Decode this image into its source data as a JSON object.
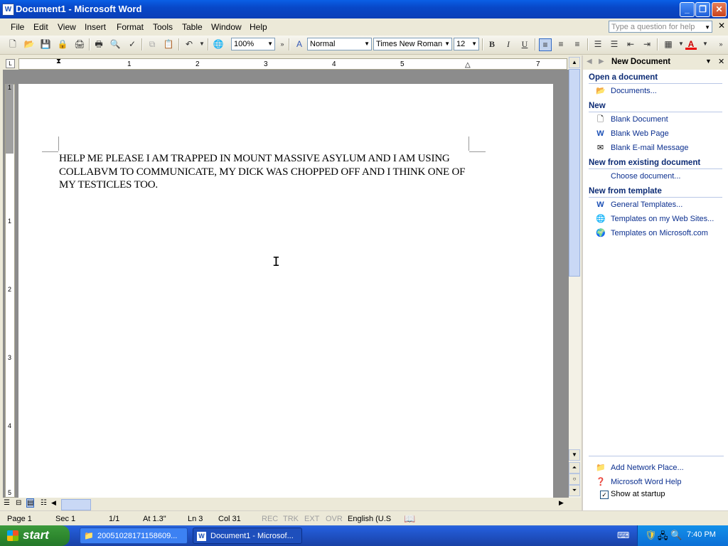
{
  "window": {
    "title": "Document1 - Microsoft Word",
    "app_icon": "W",
    "min": "_",
    "max": "❐",
    "close": "✕"
  },
  "menu": {
    "items": [
      "File",
      "Edit",
      "View",
      "Insert",
      "Format",
      "Tools",
      "Table",
      "Window",
      "Help"
    ],
    "help_placeholder": "Type a question for help"
  },
  "toolbar": {
    "zoom": "100%",
    "style": "Normal",
    "font": "Times New Roman",
    "size": "12",
    "bold": "B",
    "italic": "I",
    "underline": "U"
  },
  "ruler": {
    "h_numbers": [
      "1",
      "2",
      "3",
      "4",
      "5",
      "7"
    ],
    "v_numbers": [
      "1",
      "1",
      "2",
      "3",
      "4",
      "5"
    ]
  },
  "document": {
    "text": "HELP ME PLEASE I AM TRAPPED IN MOUNT MASSIVE ASYLUM AND I AM USING COLLABVM TO COMMUNICATE, MY DICK WAS CHOPPED OFF AND I THINK ONE OF MY TESTICLES TOO."
  },
  "taskpane": {
    "title": "New Document",
    "sections": [
      {
        "heading": "Open a document",
        "links": [
          "Documents..."
        ]
      },
      {
        "heading": "New",
        "links": [
          "Blank Document",
          "Blank Web Page",
          "Blank E-mail Message"
        ]
      },
      {
        "heading": "New from existing document",
        "links": [
          "Choose document..."
        ]
      },
      {
        "heading": "New from template",
        "links": [
          "General Templates...",
          "Templates on my Web Sites...",
          "Templates on Microsoft.com"
        ]
      }
    ],
    "footer_links": [
      "Add Network Place...",
      "Microsoft Word Help"
    ],
    "show_at_startup": "Show at startup",
    "show_at_startup_checked": true
  },
  "status": {
    "page": "Page 1",
    "sec": "Sec 1",
    "pages": "1/1",
    "at": "At 1.3\"",
    "ln": "Ln 3",
    "col": "Col 31",
    "rec": "REC",
    "trk": "TRK",
    "ext": "EXT",
    "ovr": "OVR",
    "lang": "English (U.S"
  },
  "taskbar": {
    "start": "start",
    "items": [
      "20051028171158609...",
      "Document1 - Microsof..."
    ],
    "clock": "7:40 PM"
  },
  "colors": {
    "titlebar": "#0a5fe6",
    "taskbar": "#245edb",
    "start": "#2f8a2f",
    "link": "#0b2f8f"
  }
}
